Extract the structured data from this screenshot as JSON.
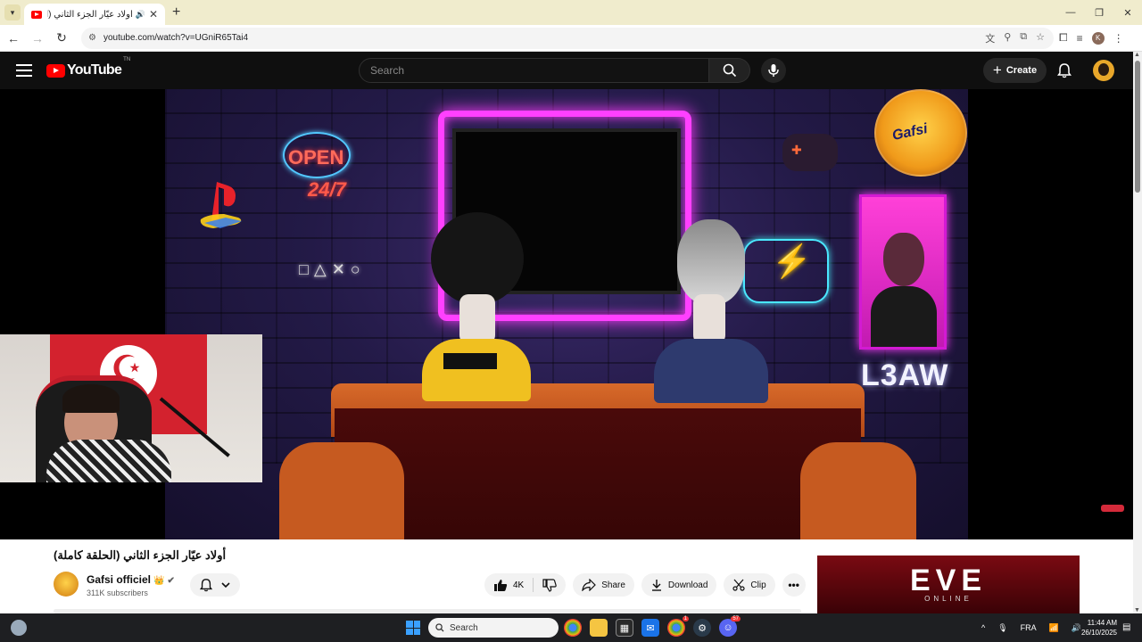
{
  "browser": {
    "tab_title": "أولاد عيّار الجزء الثاني (الحلقة...",
    "url": "youtube.com/watch?v=UGniR65Tai4",
    "profile_initial": "K"
  },
  "header": {
    "logo_text": "YouTube",
    "logo_tm": "TN",
    "search_placeholder": "Search",
    "create_label": "Create"
  },
  "video": {
    "neon_open": "OPEN",
    "neon_247": "24/7",
    "ps_buttons": "□△✕○",
    "badge_text": "Gafsi",
    "wall_text": "L3AW",
    "title": "أولاد عيّار الجزء الثاني (الحلقة كاملة)"
  },
  "channel": {
    "name": "Gafsi officiel",
    "badge_emoji": "👑",
    "verified": "✔",
    "subscribers": "311K subscribers"
  },
  "actions": {
    "like_count": "4K",
    "share_label": "Share",
    "download_label": "Download",
    "clip_label": "Clip",
    "more_label": "•••"
  },
  "ad": {
    "brand": "EVE",
    "tagline": "ONLINE"
  },
  "taskbar": {
    "search_label": "Search",
    "language": "FRA",
    "time": "11:44 AM",
    "date": "26/10/2025",
    "chrome_badge": "1",
    "discord_badge": "57"
  }
}
